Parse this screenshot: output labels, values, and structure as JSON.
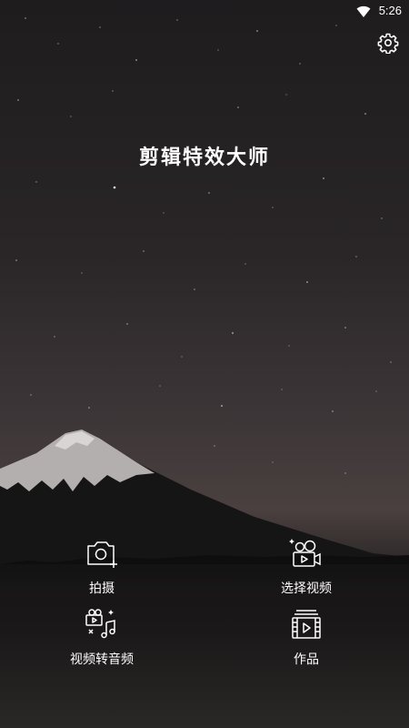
{
  "status_bar": {
    "time": "5:26",
    "wifi_icon": "wifi-icon"
  },
  "settings": {
    "icon": "gear-icon"
  },
  "app": {
    "title": "剪辑特效大师"
  },
  "menu": [
    {
      "label": "拍摄",
      "icon": "camera-add-icon"
    },
    {
      "label": "选择视频",
      "icon": "video-camera-icon"
    },
    {
      "label": "视频转音频",
      "icon": "video-to-audio-icon"
    },
    {
      "label": "作品",
      "icon": "film-works-icon"
    }
  ]
}
